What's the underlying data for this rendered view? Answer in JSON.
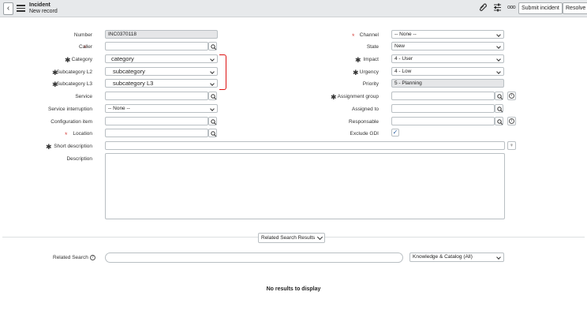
{
  "header": {
    "back_glyph": "‹",
    "title": "Incident",
    "subtitle": "New record",
    "attach_icon": "paperclip-icon",
    "settings_icon": "sliders-icon",
    "more_icon": "more-icon",
    "more_glyph": "ooo",
    "submit_label": "Submit incident",
    "resolve_label": "Resolve"
  },
  "left_fields": {
    "number": {
      "label": "Number",
      "value": "INC0370118"
    },
    "caller": {
      "label": "Caller",
      "value": ""
    },
    "category": {
      "label": "Category",
      "value": "category"
    },
    "subcategory_l2": {
      "label": "Subcategory L2",
      "value": "subcategory"
    },
    "subcategory_l3": {
      "label": "Subcategory L3",
      "value": "subcategory L3"
    },
    "service": {
      "label": "Service",
      "value": ""
    },
    "service_interruption": {
      "label": "Service interruption",
      "value": "-- None --"
    },
    "configuration_item": {
      "label": "Configuration item",
      "value": ""
    },
    "location": {
      "label": "Location",
      "value": ""
    },
    "short_description": {
      "label": "Short description",
      "value": ""
    },
    "description": {
      "label": "Description",
      "value": ""
    }
  },
  "right_fields": {
    "channel": {
      "label": "Channel",
      "value": "-- None --"
    },
    "state": {
      "label": "State",
      "value": "New"
    },
    "impact": {
      "label": "Impact",
      "value": "4 - User"
    },
    "urgency": {
      "label": "Urgency",
      "value": "4 - Low"
    },
    "priority": {
      "label": "Priority",
      "value": "5 - Planning"
    },
    "assignment_group": {
      "label": "Assignment group",
      "value": ""
    },
    "assigned_to": {
      "label": "Assigned to",
      "value": ""
    },
    "responsable": {
      "label": "Responsable",
      "value": ""
    },
    "exclude_gdi": {
      "label": "Exclude GDI",
      "checked": true,
      "check_glyph": "✓"
    }
  },
  "markers": {
    "required_glyph": "*",
    "mandatory_glyph": "✱",
    "info_glyph": "i",
    "lightbulb_glyph": "♀"
  },
  "related": {
    "button_label": "Related Search Results",
    "search_label": "Related Search",
    "help_glyph": "?",
    "search_value": "",
    "source_value": "Knowledge & Catalog (All)",
    "no_results": "No results to display"
  },
  "colors": {
    "required": "#d9534f",
    "annotation": "#dd1111",
    "header_bg": "#e7e9eb",
    "readonly_bg": "#e5e6e8"
  }
}
